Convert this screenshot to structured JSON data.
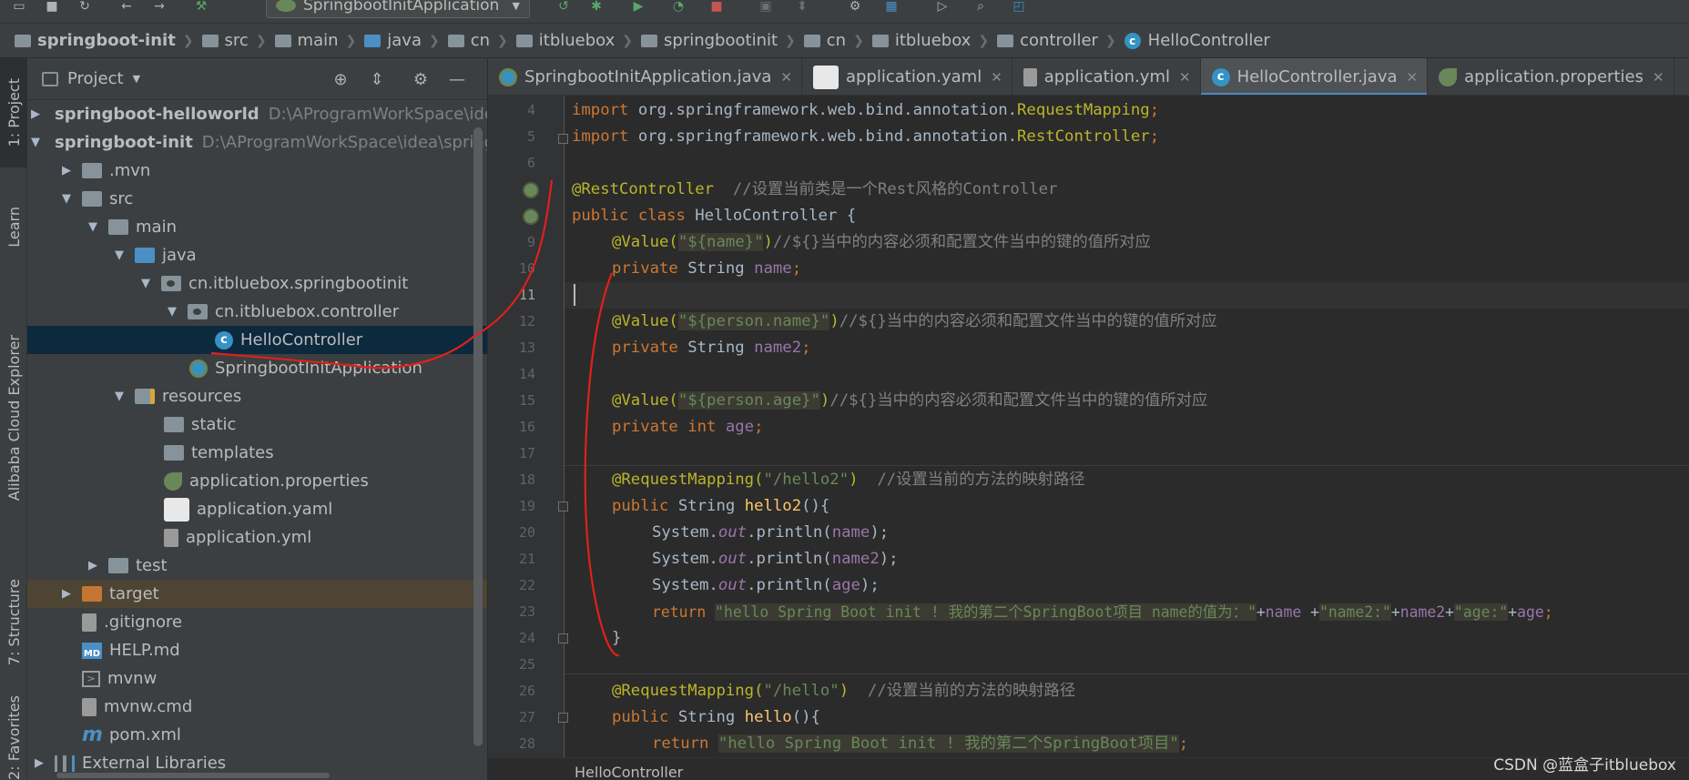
{
  "toolbar": {
    "run_config_label": "SpringbootInitApplication",
    "icons": [
      "folder-open-icon",
      "save-icon",
      "sync-icon",
      "back-icon",
      "forward-icon",
      "build-icon",
      "rerun-icon",
      "debug-icon",
      "run-coverage-icon",
      "profile-icon",
      "stop-icon",
      "attach-icon",
      "deploy-icon",
      "settings-wrench-icon",
      "project-structure-icon",
      "run-anything-icon",
      "search-icon",
      "ide-icon"
    ]
  },
  "breadcrumb": {
    "items": [
      "springboot-init",
      "src",
      "main",
      "java",
      "cn",
      "itbluebox",
      "springbootinit",
      "cn",
      "itbluebox",
      "controller",
      "HelloController"
    ]
  },
  "tool_strip": {
    "tabs": [
      "1: Project",
      "Learn",
      "Alibaba Cloud Explorer",
      "7: Structure",
      "2: Favorites"
    ]
  },
  "project_panel": {
    "title": "Project",
    "tree": [
      {
        "label": "springboot-helloworld",
        "path": "D:\\AProgramWorkSpace\\idea\\",
        "bold": true
      },
      {
        "label": "springboot-init",
        "path": "D:\\AProgramWorkSpace\\idea\\springb",
        "bold": true
      },
      {
        "label": ".mvn"
      },
      {
        "label": "src"
      },
      {
        "label": "main"
      },
      {
        "label": "java"
      },
      {
        "label": "cn.itbluebox.springbootinit"
      },
      {
        "label": "cn.itbluebox.controller"
      },
      {
        "label": "HelloController"
      },
      {
        "label": "SpringbootInitApplication"
      },
      {
        "label": "resources"
      },
      {
        "label": "static"
      },
      {
        "label": "templates"
      },
      {
        "label": "application.properties"
      },
      {
        "label": "application.yaml"
      },
      {
        "label": "application.yml"
      },
      {
        "label": "test"
      },
      {
        "label": "target"
      },
      {
        "label": ".gitignore"
      },
      {
        "label": "HELP.md"
      },
      {
        "label": "mvnw"
      },
      {
        "label": "mvnw.cmd"
      },
      {
        "label": "pom.xml"
      },
      {
        "label": "External Libraries"
      }
    ]
  },
  "editor_tabs": [
    {
      "label": "SpringbootInitApplication.java"
    },
    {
      "label": "application.yaml"
    },
    {
      "label": "application.yml"
    },
    {
      "label": "HelloController.java",
      "active": true
    },
    {
      "label": "application.properties"
    }
  ],
  "line_numbers": [
    "4",
    "5",
    "6",
    "7",
    "8",
    "9",
    "10",
    "11",
    "12",
    "13",
    "14",
    "15",
    "16",
    "17",
    "18",
    "19",
    "20",
    "21",
    "22",
    "23",
    "24",
    "25",
    "26",
    "27",
    "28"
  ],
  "code": {
    "l4": {
      "kw": "import ",
      "pkg": "org.springframework.web.bind.annotation.",
      "cls": "RequestMapping",
      "end": ";"
    },
    "l5": {
      "kw": "import ",
      "pkg": "org.springframework.web.bind.annotation.",
      "cls": "RestController",
      "end": ";"
    },
    "l7": {
      "ann": "@RestController",
      "cmt": "  //设置当前类是一个Rest风格的Controller"
    },
    "l8": {
      "kw": "public class ",
      "cls": "HelloController",
      "end": " {"
    },
    "l9": {
      "ann": "@Value(",
      "str": "\"${name}\"",
      "ann2": ")",
      "cmt": "//${}当中的内容必须和配置文件当中的键的值所对应"
    },
    "l10": {
      "kw": "private ",
      "type": "String ",
      "fld": "name",
      "end": ";"
    },
    "l12": {
      "ann": "@Value(",
      "str": "\"${person.name}\"",
      "ann2": ")",
      "cmt": "//${}当中的内容必须和配置文件当中的键的值所对应"
    },
    "l13": {
      "kw": "private ",
      "type": "String ",
      "fld": "name2",
      "end": ";"
    },
    "l15": {
      "ann": "@Value(",
      "str": "\"${person.age}\"",
      "ann2": ")",
      "cmt": "//${}当中的内容必须和配置文件当中的键的值所对应"
    },
    "l16": {
      "kw": "private int ",
      "fld": "age",
      "end": ";"
    },
    "l18": {
      "ann": "@RequestMapping(",
      "str": "\"/hello2\"",
      "ann2": ")",
      "cmt": "  //设置当前的方法的映射路径"
    },
    "l19": {
      "kw": "public ",
      "type": "String ",
      "mth": "hello2",
      "end": "(){"
    },
    "l20": {
      "cls": "System.",
      "static": "out",
      "call": ".println(",
      "fld": "name",
      "end": ");"
    },
    "l21": {
      "cls": "System.",
      "static": "out",
      "call": ".println(",
      "fld": "name2",
      "end": ");"
    },
    "l22": {
      "cls": "System.",
      "static": "out",
      "call": ".println(",
      "fld": "age",
      "end": ");"
    },
    "l23": {
      "kw": "return ",
      "str1": "\"hello Spring Boot init ! 我的第二个SpringBoot项目 name的值为：\"",
      "op1": "+",
      "fld1": "name",
      "op2": " +",
      "str2": "\"name2:\"",
      "op3": "+",
      "fld2": "name2",
      "op4": "+",
      "str3": "\"age:\"",
      "op5": "+",
      "fld3": "age",
      "end": ";"
    },
    "l24": {
      "end": "}"
    },
    "l26": {
      "ann": "@RequestMapping(",
      "str": "\"/hello\"",
      "ann2": ")",
      "cmt": "  //设置当前的方法的映射路径"
    },
    "l27": {
      "kw": "public ",
      "type": "String ",
      "mth": "hello",
      "end": "(){"
    },
    "l28": {
      "kw": "return ",
      "str": "\"hello Spring Boot init ! 我的第二个SpringBoot项目\"",
      "end": ";"
    }
  },
  "footer": {
    "breadcrumb": "HelloController"
  },
  "watermark": "CSDN @蓝盒子itbluebox",
  "colors": {
    "keyword": "#cc7832",
    "annotation": "#bbb529",
    "string": "#6a8759",
    "comment": "#808080",
    "field": "#9876aa",
    "method": "#ffc66d",
    "selection": "#0d293e",
    "accent": "#4a88c7",
    "red_marker": "#e0201b"
  }
}
